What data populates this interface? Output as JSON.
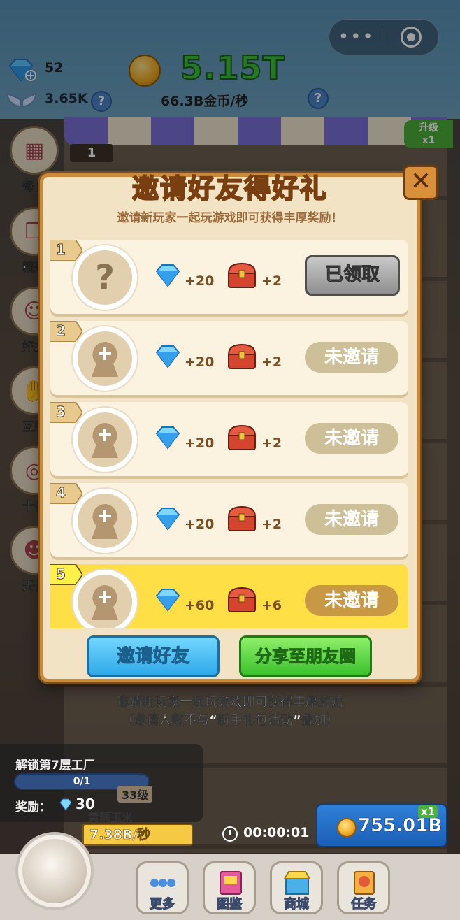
{
  "hud": {
    "gems": "52",
    "wings": "3.65K",
    "money": "5.15T",
    "rate": "66.3B金币/秒",
    "help_label": "?"
  },
  "capsule": {
    "more_label": "•••"
  },
  "upgrade": {
    "label": "升级",
    "multiplier": "x1"
  },
  "floor_badge": "1",
  "side_menu": [
    {
      "label": "每日",
      "icon": "calendar-icon"
    },
    {
      "label": "精彩",
      "icon": "gift-icon"
    },
    {
      "label": "好友",
      "icon": "friend-icon"
    },
    {
      "label": "互助",
      "icon": "handshake-icon"
    },
    {
      "label": "十倍",
      "icon": "coins-icon"
    },
    {
      "label": "天使",
      "icon": "angel-icon"
    }
  ],
  "modal": {
    "title": "邀请好友得好礼",
    "close_label": "✕",
    "subtitle": "邀请新玩家一起玩游戏即可获得丰厚奖励！",
    "rows": [
      {
        "num": "1",
        "gems": "+20",
        "chests": "+2",
        "status": "已领取",
        "state": "claimed",
        "avatar": "question-mark"
      },
      {
        "num": "2",
        "gems": "+20",
        "chests": "+2",
        "status": "未邀请",
        "state": "pending",
        "avatar": "placeholder"
      },
      {
        "num": "3",
        "gems": "+20",
        "chests": "+2",
        "status": "未邀请",
        "state": "pending",
        "avatar": "placeholder"
      },
      {
        "num": "4",
        "gems": "+20",
        "chests": "+2",
        "status": "未邀请",
        "state": "pending",
        "avatar": "placeholder"
      },
      {
        "num": "5",
        "gems": "+60",
        "chests": "+6",
        "status": "未邀请",
        "state": "pending",
        "avatar": "placeholder",
        "highlight": true
      }
    ],
    "invite_button": "邀请好友",
    "share_button": "分享至朋友圈"
  },
  "notes": {
    "line1": "邀请新玩家一起玩游戏即可获得丰厚奖励",
    "line2": "（邀请人数不与“新手礼包活动”叠加）"
  },
  "unlock": {
    "title": "解锁第7层工厂",
    "progress_text": "0/1",
    "progress": 0.0,
    "reward_label": "奖励：",
    "reward_value": "30"
  },
  "production": {
    "level": "33级",
    "name": "黄糯玉米",
    "rate": "7.38B/秒",
    "timer": "00:00:01",
    "collect_value": "755.01B",
    "collect_multiplier": "x1"
  },
  "bottom_nav": [
    {
      "label": "更多",
      "icon": "more-icon"
    },
    {
      "label": "图鉴",
      "icon": "book-icon"
    },
    {
      "label": "商城",
      "icon": "shop-icon"
    },
    {
      "label": "任务",
      "icon": "task-icon"
    }
  ],
  "colors": {
    "modal_bg": "#f2e3c4",
    "modal_border": "#c98a3c",
    "money_green": "#3ec33a",
    "highlight_row": "#ffde46",
    "invite_blue": "#2ea8e8",
    "share_green": "#3cbf2c"
  }
}
